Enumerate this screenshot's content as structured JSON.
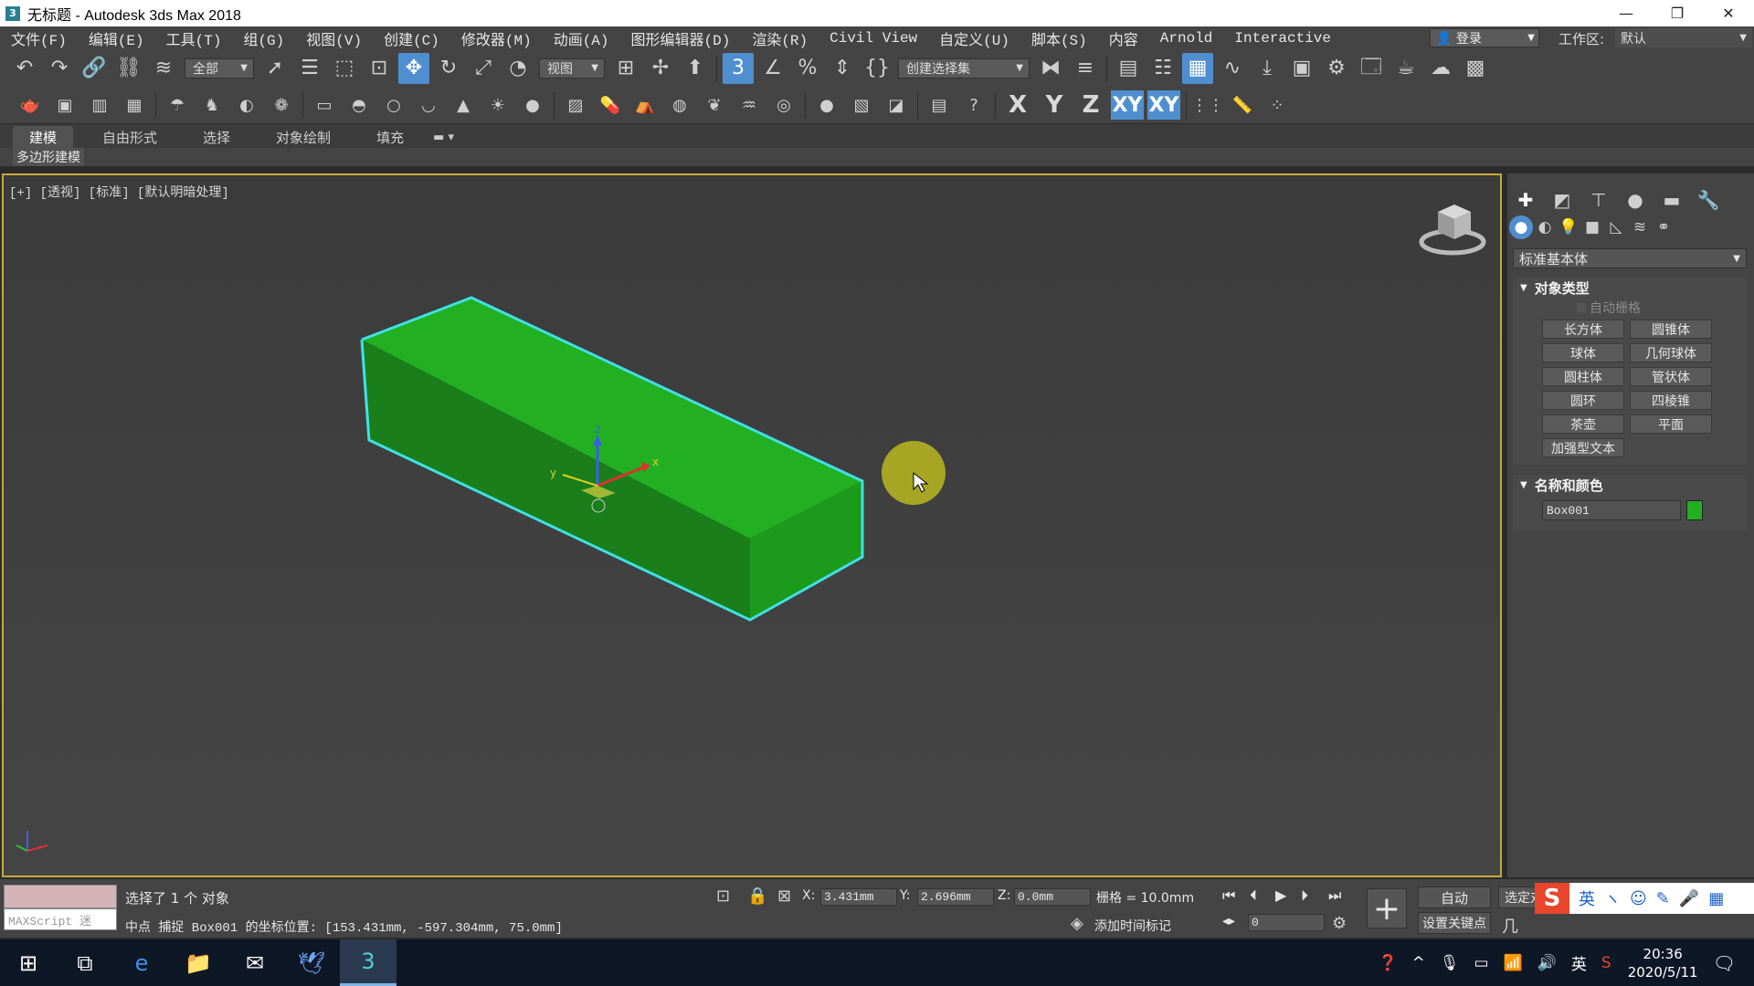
{
  "window": {
    "title": "无标题 - Autodesk 3ds Max 2018",
    "app_icon": "3"
  },
  "menu": {
    "items": [
      "文件(F)",
      "编辑(E)",
      "工具(T)",
      "组(G)",
      "视图(V)",
      "创建(C)",
      "修改器(M)",
      "动画(A)",
      "图形编辑器(D)",
      "渲染(R)",
      "Civil View",
      "自定义(U)",
      "脚本(S)",
      "内容",
      "Arnold",
      "Interactive"
    ],
    "login": "登录",
    "workspace_label": "工作区:",
    "workspace_value": "默认"
  },
  "toolbar": {
    "selection_filter": "全部",
    "ref_coord": "视图",
    "named_selection": "创建选择集",
    "axis_x": "X",
    "axis_y": "Y",
    "axis_z": "Z",
    "axis_xy": "XY",
    "axis_xy2": "XY"
  },
  "ribbon": {
    "tabs": [
      "建模",
      "自由形式",
      "选择",
      "对象绘制",
      "填充"
    ],
    "active_tab": "建模",
    "sub_label": "多边形建模"
  },
  "viewport": {
    "label": "[+] [透视] [标准] [默认明暗处理]",
    "gizmo": {
      "x": "x",
      "y": "y",
      "z": "z"
    },
    "object_color": "#22b022",
    "highlight_color": "#40e0e8"
  },
  "command_panel": {
    "category": "标准基本体",
    "object_type_title": "对象类型",
    "autogrid": "自动栅格",
    "object_buttons": [
      "长方体",
      "圆锥体",
      "球体",
      "几何球体",
      "圆柱体",
      "管状体",
      "圆环",
      "四棱锥",
      "茶壶",
      "平面",
      "加强型文本"
    ],
    "name_color_title": "名称和颜色",
    "object_name": "Box001",
    "object_color": "#22b022"
  },
  "status": {
    "maxscript_label": "MAXScript 迷",
    "selected": "选择了 1 个 对象",
    "prompt": "中点 捕捉 Box001 的坐标位置: [153.431mm, -597.304mm, 75.0mm]",
    "x_label": "X:",
    "x_value": "3.431mm",
    "y_label": "Y:",
    "y_value": "2.696mm",
    "z_label": "Z:",
    "z_value": "0.0mm",
    "grid": "栅格 = 10.0mm",
    "add_time_tag": "添加时间标记",
    "auto_key": "自动",
    "set_key": "设置关键点",
    "key_filter": "选定对象",
    "frame": "0"
  },
  "ime": {
    "items": [
      "英",
      "ヽ",
      "☺",
      "✎",
      "🎤",
      "▦"
    ]
  },
  "taskbar": {
    "tray_lang": "英",
    "time": "20:36",
    "date": "2020/5/11"
  }
}
